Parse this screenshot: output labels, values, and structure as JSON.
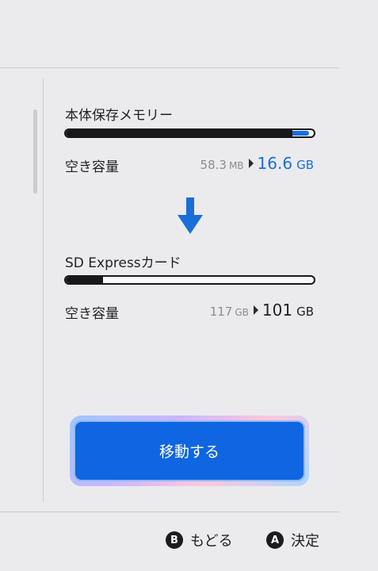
{
  "internal_memory": {
    "title": "本体保存メモリー",
    "usage_fraction": 0.915,
    "added_fraction": 0.065,
    "free_label": "空き容量",
    "free_before_value": "58.3",
    "free_before_unit": "MB",
    "free_after_value": "16.6",
    "free_after_unit": "GB"
  },
  "sd_card": {
    "title": "SD Expressカード",
    "usage_fraction": 0.15,
    "free_label": "空き容量",
    "free_before_value": "117",
    "free_before_unit": "GB",
    "free_after_value": "101",
    "free_after_unit": "GB"
  },
  "move_button": {
    "label": "移動する"
  },
  "footer": {
    "back_glyph": "B",
    "back_label": "もどる",
    "confirm_glyph": "A",
    "confirm_label": "決定"
  },
  "colors": {
    "accent": "#1a6ed8",
    "button": "#0f66e0",
    "bar_fill": "#18181b",
    "background": "#ebebee"
  }
}
